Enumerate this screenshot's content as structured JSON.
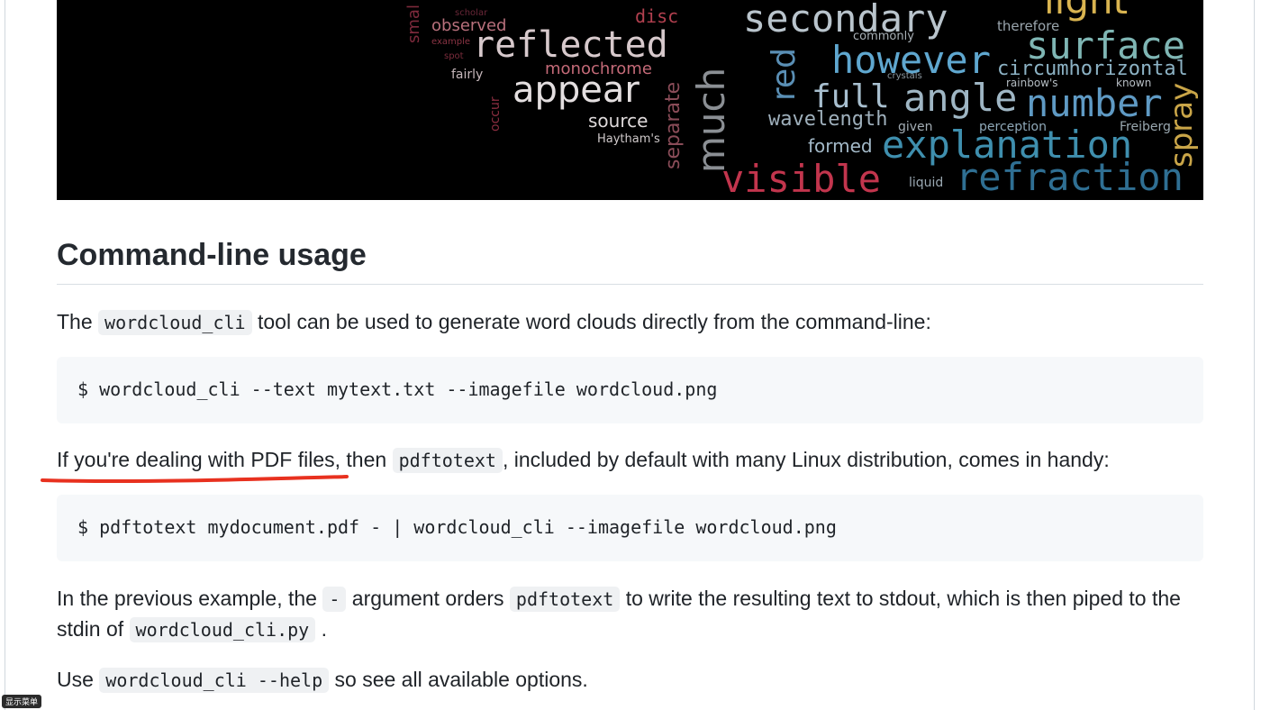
{
  "banner": {
    "words": [
      {
        "text": "smal",
        "color": "#7d2a3c"
      },
      {
        "text": "scholar",
        "color": "#6a2738"
      },
      {
        "text": "observed",
        "color": "#b8707c"
      },
      {
        "text": "example",
        "color": "#8a3444"
      },
      {
        "text": "spot",
        "color": "#7a2c3c"
      },
      {
        "text": "reflected",
        "color": "#d7c9cc"
      },
      {
        "text": "fairly",
        "color": "#c6b7bb"
      },
      {
        "text": "monochrome",
        "color": "#c46a78"
      },
      {
        "text": "appear",
        "color": "#e4dfe0"
      },
      {
        "text": "source",
        "color": "#dfdadb"
      },
      {
        "text": "Haytham's",
        "color": "#cfc9ca"
      },
      {
        "text": "occur",
        "color": "#8b2e40"
      },
      {
        "text": "disc",
        "color": "#b2404f"
      },
      {
        "text": "separate",
        "color": "#8a4c58"
      },
      {
        "text": "much",
        "color": "#8b8f94"
      },
      {
        "text": "red",
        "color": "#5a8fb5"
      },
      {
        "text": "secondary",
        "color": "#b9c4cc"
      },
      {
        "text": "however",
        "color": "#5fa7cf"
      },
      {
        "text": "full",
        "color": "#a8bfcf"
      },
      {
        "text": "formed",
        "color": "#a3b9c8"
      },
      {
        "text": "wavelength",
        "color": "#9fb0bc"
      },
      {
        "text": "visible",
        "color": "#c2354d"
      },
      {
        "text": "commonly",
        "color": "#a8b0b6"
      },
      {
        "text": "angle",
        "color": "#9fb6c4"
      },
      {
        "text": "explanation",
        "color": "#3f8fae"
      },
      {
        "text": "liquid",
        "color": "#9aa8b2"
      },
      {
        "text": "refraction",
        "color": "#2f6f93"
      },
      {
        "text": "therefore",
        "color": "#9aa5ad"
      },
      {
        "text": "surface",
        "color": "#7fb6b4"
      },
      {
        "text": "circumhorizontal",
        "color": "#8cb2c4"
      },
      {
        "text": "number",
        "color": "#5f9ac4"
      },
      {
        "text": "rainbow's",
        "color": "#b4bcc2"
      },
      {
        "text": "known",
        "color": "#b7bec4"
      },
      {
        "text": "perception",
        "color": "#8fa8b8"
      },
      {
        "text": "Freiberg",
        "color": "#9aa8b0"
      },
      {
        "text": "spray",
        "color": "#c9a548"
      },
      {
        "text": "light",
        "color": "#d9b450"
      },
      {
        "text": "given",
        "color": "#a3adb4"
      },
      {
        "text": "crystals",
        "color": "#8a969e"
      }
    ]
  },
  "section": {
    "heading": "Command-line usage",
    "p1": {
      "before": "The",
      "code": "wordcloud_cli",
      "after": "tool can be used to generate word clouds directly from the command-line:"
    },
    "block1": "$ wordcloud_cli --text mytext.txt --imagefile wordcloud.png",
    "p2": {
      "before": "If you're dealing with PDF files, then",
      "code": "pdftotext",
      "after": ", included by default with many Linux distribution, comes in handy:"
    },
    "block2": "$ pdftotext mydocument.pdf - | wordcloud_cli --imagefile wordcloud.png",
    "p3": {
      "t1": "In the previous example, the",
      "c1": "-",
      "t2": "argument orders",
      "c2": "pdftotext",
      "t3": "to write the resulting text to stdout, which is then piped to the",
      "t4": "stdin of",
      "c3": "wordcloud_cli.py",
      "t5": "."
    },
    "p4": {
      "before": "Use",
      "code": "wordcloud_cli --help",
      "after": "so see all available options."
    }
  },
  "annotation": {
    "underline_color": "#e8311f"
  },
  "footer": {
    "menu_label": "显示菜单"
  }
}
